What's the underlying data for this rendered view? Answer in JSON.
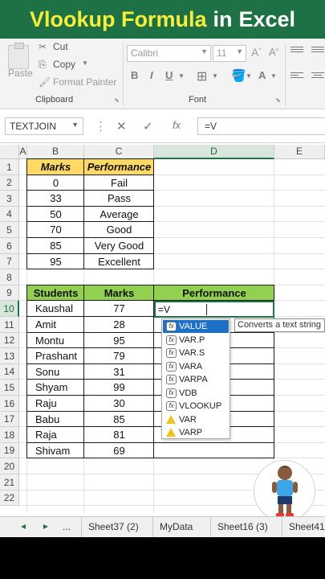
{
  "banner": {
    "part1": "Vlookup Formula",
    "part2": "in",
    "part3": "Excel"
  },
  "ribbon": {
    "paste": "Paste",
    "cut": "Cut",
    "copy": "Copy",
    "format_painter": "Format Painter",
    "clipboard_label": "Clipboard",
    "font_name": "Calibri",
    "font_size": "11",
    "font_label": "Font",
    "bold": "B",
    "italic": "I",
    "underline": "U"
  },
  "formula_bar": {
    "name_box": "TEXTJOIN",
    "fx": "fx",
    "content": "=V"
  },
  "columns": [
    "A",
    "B",
    "C",
    "D",
    "E"
  ],
  "rows": [
    "1",
    "2",
    "3",
    "4",
    "5",
    "6",
    "7",
    "8",
    "9",
    "10",
    "11",
    "12",
    "13",
    "14",
    "15",
    "16",
    "17",
    "18",
    "19",
    "20",
    "21",
    "22"
  ],
  "table1": {
    "headers": [
      "Marks",
      "Performance"
    ],
    "rows": [
      [
        "0",
        "Fail"
      ],
      [
        "33",
        "Pass"
      ],
      [
        "50",
        "Average"
      ],
      [
        "70",
        "Good"
      ],
      [
        "85",
        "Very Good"
      ],
      [
        "95",
        "Excellent"
      ]
    ]
  },
  "table2": {
    "headers": [
      "Students",
      "Marks",
      "Performance"
    ],
    "rows": [
      [
        "Kaushal",
        "77"
      ],
      [
        "Amit",
        "28"
      ],
      [
        "Montu",
        "95"
      ],
      [
        "Prashant",
        "79"
      ],
      [
        "Sonu",
        "31"
      ],
      [
        "Shyam",
        "99"
      ],
      [
        "Raju",
        "30"
      ],
      [
        "Babu",
        "85"
      ],
      [
        "Raja",
        "81"
      ],
      [
        "Shivam",
        "69"
      ]
    ]
  },
  "active_cell_value": "=V",
  "autocomplete": {
    "items": [
      {
        "label": "VALUE",
        "icon": "function-icon"
      },
      {
        "label": "VAR.P",
        "icon": "function-icon"
      },
      {
        "label": "VAR.S",
        "icon": "function-icon"
      },
      {
        "label": "VARA",
        "icon": "function-icon"
      },
      {
        "label": "VARPA",
        "icon": "function-icon"
      },
      {
        "label": "VDB",
        "icon": "function-icon"
      },
      {
        "label": "VLOOKUP",
        "icon": "function-icon"
      },
      {
        "label": "VAR",
        "icon": "warning-function-icon"
      },
      {
        "label": "VARP",
        "icon": "warning-function-icon"
      }
    ],
    "tooltip": "Converts a text string"
  },
  "sheet_tabs": [
    "...",
    "Sheet37 (2)",
    "MyData",
    "Sheet16 (3)",
    "Sheet41"
  ]
}
